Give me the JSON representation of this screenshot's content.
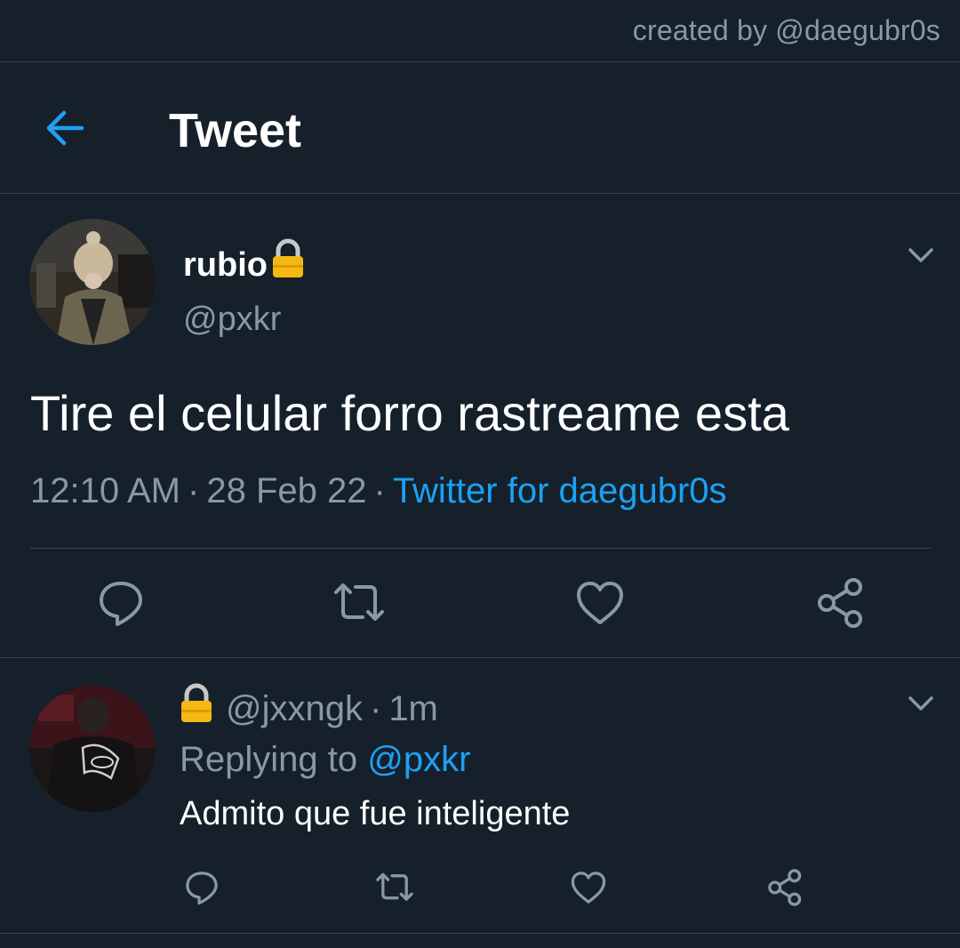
{
  "credit": "created by @daegubr0s",
  "header": {
    "title": "Tweet",
    "back_icon": "arrow-left-icon"
  },
  "colors": {
    "background": "#15202b",
    "accent": "#1da1f2",
    "muted": "#8899a6",
    "divider": "#38444d"
  },
  "tweet": {
    "name": "rubio",
    "handle": "@pxkr",
    "text": "Tire el celular forro rastreame esta",
    "time": "12:10 AM",
    "date": "28 Feb 22",
    "source": "Twitter for daegubr0s",
    "separator": "·",
    "actions": [
      "reply-icon",
      "retweet-icon",
      "like-icon",
      "share-icon"
    ]
  },
  "reply": {
    "handle": "@jxxngk",
    "time": "1m",
    "separator": "·",
    "replying_prefix": "Replying to",
    "replying_to": "@pxkr",
    "text": "Admito que fue inteligente",
    "actions": [
      "reply-icon",
      "retweet-icon",
      "like-icon",
      "share-icon"
    ]
  }
}
